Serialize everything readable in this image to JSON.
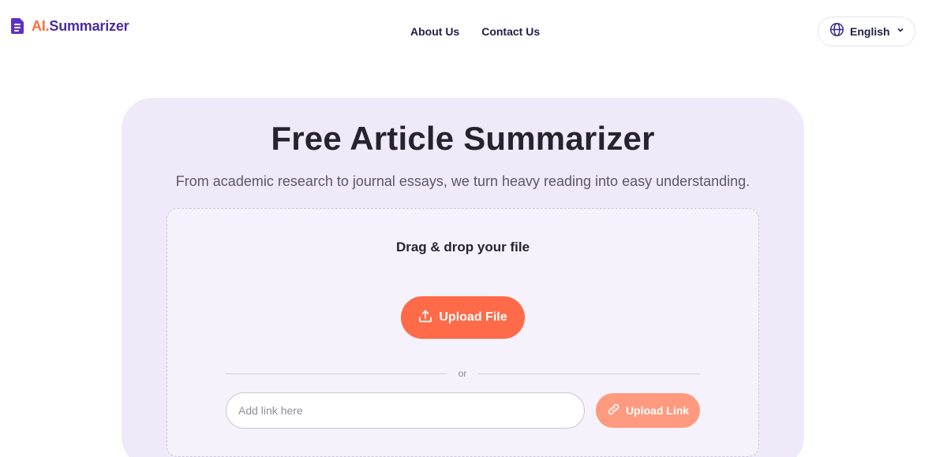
{
  "header": {
    "logo": {
      "ai_part": "AI.",
      "name_part": "Summarizer",
      "icon": "document-icon"
    },
    "nav": [
      {
        "label": "About Us"
      },
      {
        "label": "Contact Us"
      }
    ],
    "language": {
      "label": "English",
      "icon": "globe-icon",
      "caret_icon": "chevron-down-icon"
    }
  },
  "hero": {
    "title": "Free Article Summarizer",
    "subtitle": "From academic research to journal essays, we turn heavy reading into easy understanding."
  },
  "dropzone": {
    "title": "Drag & drop your file",
    "upload_file_label": "Upload File",
    "upload_file_icon": "upload-icon",
    "or_label": "or",
    "link_placeholder": "Add link here",
    "link_value": "",
    "upload_link_label": "Upload Link",
    "upload_link_icon": "link-icon"
  },
  "colors": {
    "brand_orange": "#ff6a48",
    "brand_orange_light": "#ff9a80",
    "brand_purple": "#4a2d9c",
    "card_bg": "#efe9f9",
    "dropzone_bg": "#f5f2fb"
  }
}
